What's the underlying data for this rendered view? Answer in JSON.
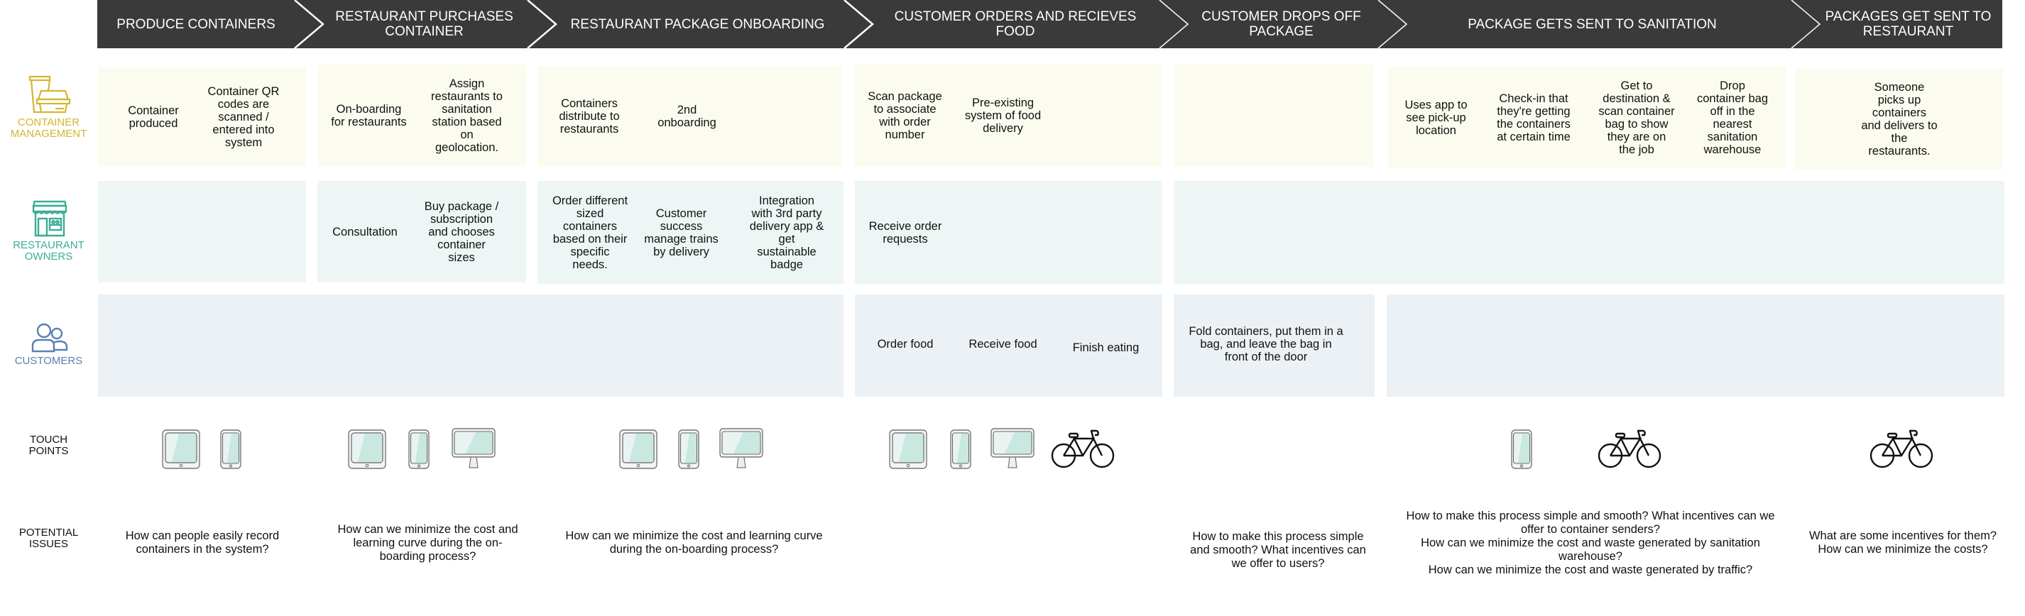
{
  "stages": [
    {
      "title": "PRODUCE CONTAINERS"
    },
    {
      "title": "RESTAURANT PURCHASES\nCONTAINER"
    },
    {
      "title": "RESTAURANT PACKAGE ONBOARDING"
    },
    {
      "title": "CUSTOMER ORDERS AND RECIEVES FOOD"
    },
    {
      "title": "CUSTOMER DROPS OFF\nPACKAGE"
    },
    {
      "title": "PACKAGE GETS SENT TO SANITATION"
    },
    {
      "title": "PACKAGES GET SENT\nTO RESTAURANT"
    }
  ],
  "lanes": {
    "container_management": {
      "label": "CONTAINER\nMANAGEMENT",
      "icon": "food-container-icon",
      "color": "#d2b72e",
      "notes": [
        "Container\nproduced",
        "Container QR\ncodes are\nscanned /\nentered into\nsystem",
        "On-boarding\nfor restaurants",
        "Assign\nrestaurants to\nsanitation\nstation based\non\ngeolocation.",
        "Containers\ndistribute to\nrestaurants",
        "2nd\nonboarding",
        "Scan package\nto associate\nwith order\nnumber",
        "Pre-existing\nsystem of food\ndelivery",
        "Uses app to\nsee pick-up\nlocation",
        "Check-in that\nthey're getting\nthe containers\nat certain time",
        "Get to\ndestination &\nscan container\nbag to show\nthey are on\nthe job",
        "Drop\ncontainer bag\noff in the\nnearest\nsanitation\nwarehouse",
        "Someone\npicks up\ncontainers\nand delivers to\nthe\nrestaurants."
      ]
    },
    "restaurant_owners": {
      "label": "RESTAURANT\nOWNERS",
      "icon": "storefront-icon",
      "color": "#3aae96",
      "notes": [
        "Consultation",
        "Buy package /\nsubscription\nand chooses\ncontainer\nsizes",
        "Order different\nsized\ncontainers\nbased on their\nspecific\nneeds.",
        "Customer\nsuccess\nmanage trains\nby delivery",
        "Integration\nwith 3rd party\ndelivery app &\nget\nsustainable\nbadge",
        "Receive order\nrequests"
      ]
    },
    "customers": {
      "label": "CUSTOMERS",
      "icon": "users-icon",
      "color": "#5a80b0",
      "notes": [
        "Order food",
        "Receive food",
        "Finish eating",
        "Fold containers, put them in a\nbag, and leave the bag in\nfront of the door"
      ]
    }
  },
  "touch_points": {
    "label": "TOUCH\nPOINTS",
    "groups": [
      [
        "tablet-icon",
        "phone-icon"
      ],
      [
        "tablet-icon",
        "phone-icon",
        "monitor-icon"
      ],
      [
        "tablet-icon",
        "phone-icon",
        "monitor-icon"
      ],
      [
        "tablet-icon",
        "phone-icon",
        "monitor-icon",
        "bicycle-icon"
      ],
      [],
      [
        "phone-icon",
        "bicycle-icon"
      ],
      [
        "bicycle-icon"
      ]
    ]
  },
  "potential_issues": {
    "label": "POTENTIAL\nISSUES",
    "items": [
      "How can people easily record\ncontainers in the system?",
      "How can we minimize the cost and\nlearning curve during the on-\nboarding process?",
      "How can we minimize the cost and learning curve\nduring the on-boarding process?",
      "",
      "How to make this process simple\nand smooth? What incentives can\nwe offer to users?",
      "How to make this process simple and smooth? What incentives can we\noffer to container senders?\nHow can we minimize the cost and waste generated by sanitation\nwarehouse?\nHow can we minimize the cost and waste generated by traffic?",
      "What are some incentives for them?\nHow can we minimize the costs?"
    ]
  },
  "colors": {
    "header_bg": "#3a3a3a",
    "container_row_bg": "#fbfbf0",
    "restaurant_row_bg": "#eef6f5",
    "customers_row_bg": "#ecf1f5",
    "device_screen": "#c8e8e0"
  }
}
